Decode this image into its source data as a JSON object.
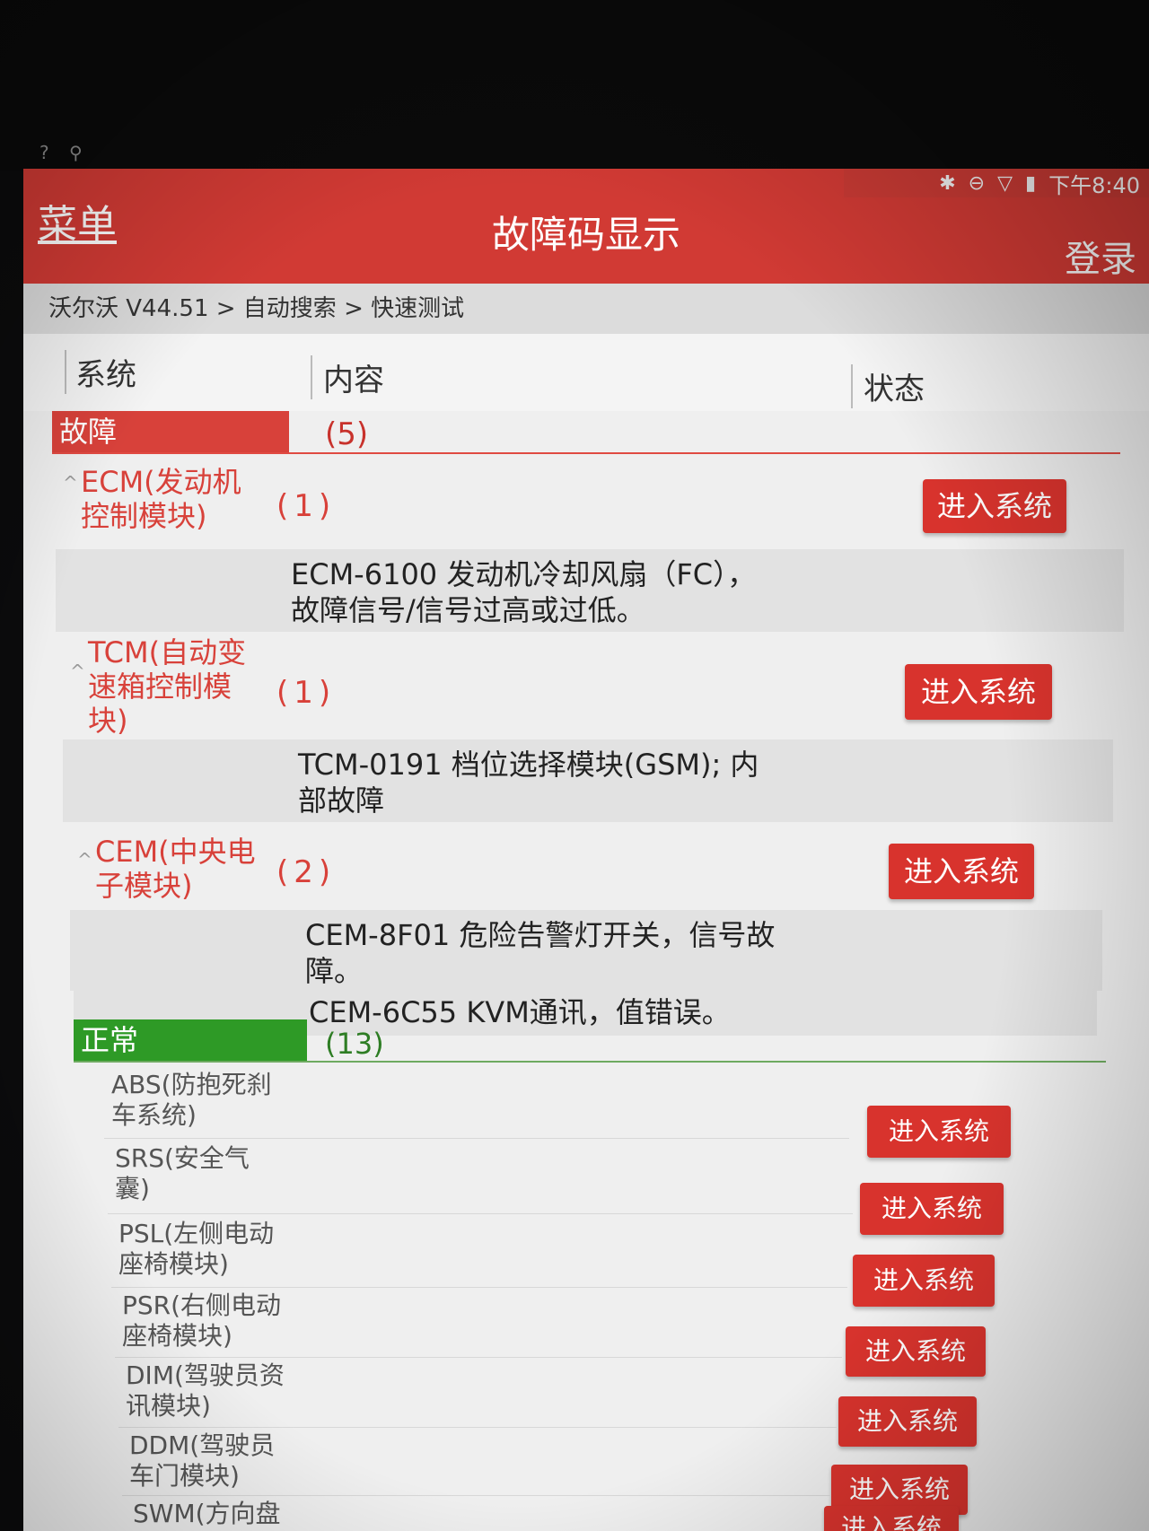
{
  "system_icons": "? ⚲",
  "status": {
    "bluetooth": "bluetooth-icon",
    "dnd": "do-not-disturb-icon",
    "wifi": "wifi-icon",
    "battery": "battery-icon",
    "time": "下午8:40"
  },
  "header": {
    "menu_label": "菜单",
    "title": "故障码显示",
    "login_label": "登录"
  },
  "breadcrumb": "沃尔沃 V44.51 > 自动搜索 > 快速测试",
  "columns": {
    "system": "系统",
    "content": "内容",
    "status": "状态"
  },
  "fault_section": {
    "label": "故障",
    "count": "(5)",
    "systems": [
      {
        "name": "ECM(发动机控制模块)",
        "name_lines": [
          "ECM(发动机",
          "控制模块)"
        ],
        "count": "(1)",
        "button": "进入系统",
        "codes": [
          "ECM-6100 发动机冷却风扇（FC），故障信号/信号过高或过低。"
        ],
        "code_lines": [
          [
            "ECM-6100 发动机冷却风扇（FC），",
            "故障信号/信号过高或过低。"
          ]
        ]
      },
      {
        "name": "TCM(自动变速箱控制模块)",
        "name_lines": [
          "TCM(自动变",
          "速箱控制模",
          "块)"
        ],
        "count": "(1)",
        "button": "进入系统",
        "codes": [
          "TCM-0191 档位选择模块(GSM); 内部故障"
        ],
        "code_lines": [
          [
            "TCM-0191 档位选择模块(GSM); 内",
            "部故障"
          ]
        ]
      },
      {
        "name": "CEM(中央电子模块)",
        "name_lines": [
          "CEM(中央电",
          "子模块)"
        ],
        "count": "(2)",
        "button": "进入系统",
        "codes": [
          "CEM-8F01 危险告警灯开关，信号故障。",
          "CEM-6C55 KVM通讯，值错误。"
        ],
        "code_lines": [
          [
            "CEM-8F01 危险告警灯开关，信号故",
            "障。"
          ],
          [
            "CEM-6C55 KVM通讯，值错误。"
          ]
        ]
      }
    ]
  },
  "normal_section": {
    "label": "正常",
    "count": "(13)",
    "systems": [
      {
        "name_lines": [
          "ABS(防抱死刹",
          "车系统)"
        ],
        "button": "进入系统"
      },
      {
        "name_lines": [
          "SRS(安全气",
          "囊)"
        ],
        "button": "进入系统"
      },
      {
        "name_lines": [
          "PSL(左侧电动",
          "座椅模块)"
        ],
        "button": "进入系统"
      },
      {
        "name_lines": [
          "PSR(右侧电动",
          "座椅模块)"
        ],
        "button": "进入系统"
      },
      {
        "name_lines": [
          "DIM(驾驶员资",
          "讯模块)"
        ],
        "button": "进入系统"
      },
      {
        "name_lines": [
          "DDM(驾驶员",
          "车门模块)"
        ],
        "button": "进入系统"
      },
      {
        "name_lines": [
          "SWM(方向盘"
        ],
        "button": "进入系统"
      }
    ]
  },
  "colors": {
    "header_red": "#d13a34",
    "fault_red": "#d8413a",
    "normal_green": "#2e9a26",
    "button_red": "#d8332d"
  }
}
